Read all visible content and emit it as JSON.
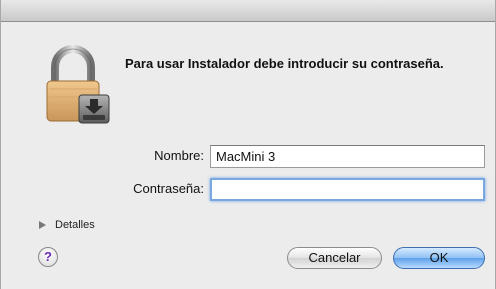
{
  "dialog": {
    "message": "Para usar Instalador debe introducir su contraseña."
  },
  "form": {
    "name_label": "Nombre:",
    "name_value": "MacMini 3",
    "password_label": "Contraseña:",
    "password_value": ""
  },
  "details": {
    "label": "Detalles"
  },
  "help": {
    "glyph": "?"
  },
  "buttons": {
    "cancel": "Cancelar",
    "ok": "OK"
  },
  "colors": {
    "focus_ring": "#7aa7dd",
    "ok_button": "#5ea1ea",
    "help_glyph": "#6a2bb3"
  }
}
